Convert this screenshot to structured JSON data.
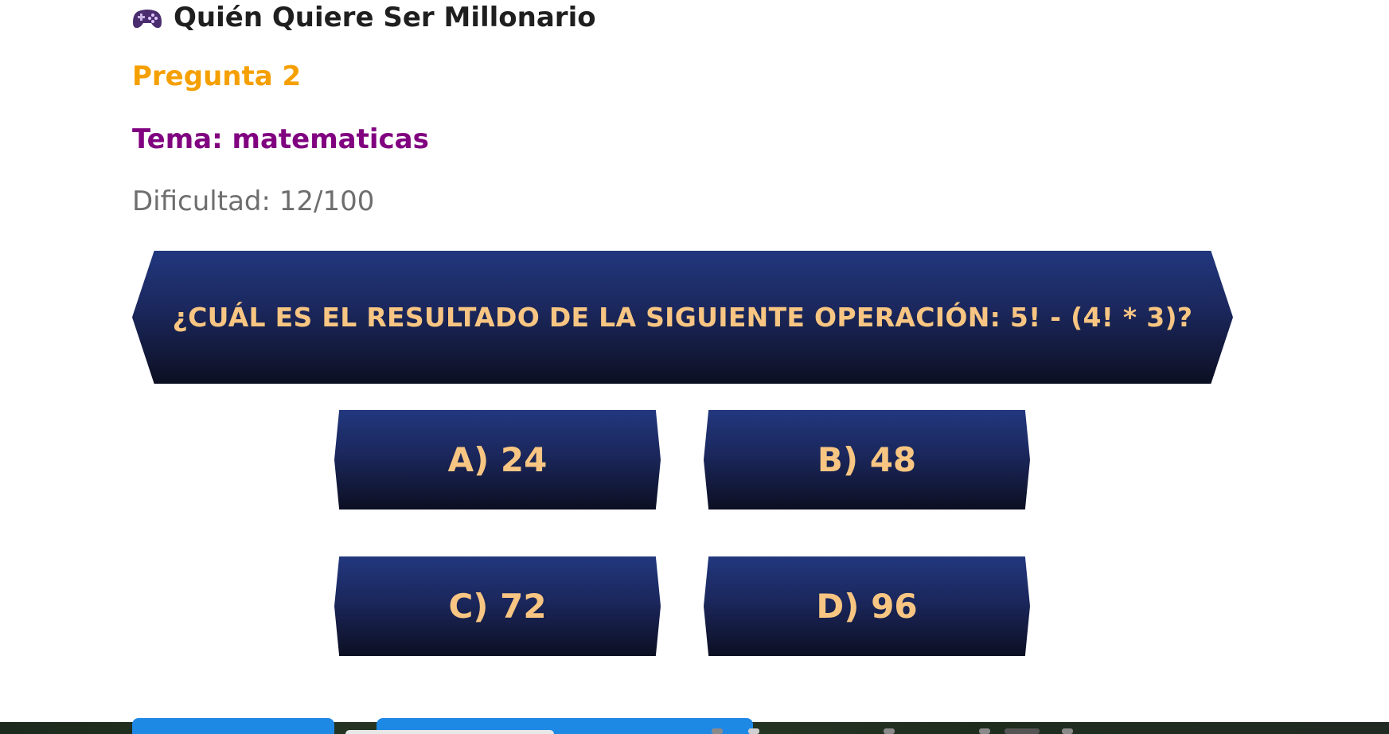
{
  "header": {
    "title": "Quién Quiere Ser Millonario",
    "icon": "game-controller-icon"
  },
  "game": {
    "question_number": "Pregunta 2",
    "topic": "Tema: matematicas",
    "difficulty": "Dificultad: 12/100",
    "question": "¿CUÁL ES EL RESULTADO DE LA SIGUIENTE OPERACIÓN: 5! - (4! * 3)?",
    "answers": [
      {
        "label": "A) 24"
      },
      {
        "label": "B) 48"
      },
      {
        "label": "C) 72"
      },
      {
        "label": "D) 96"
      }
    ]
  },
  "colors": {
    "question_number": "#f5a000",
    "topic": "#800080",
    "difficulty": "#6e6e6e",
    "panel_top": "#22377e",
    "panel_bottom": "#0c0f22",
    "panel_text": "#f8c682",
    "button_blue": "#1e88e5"
  }
}
